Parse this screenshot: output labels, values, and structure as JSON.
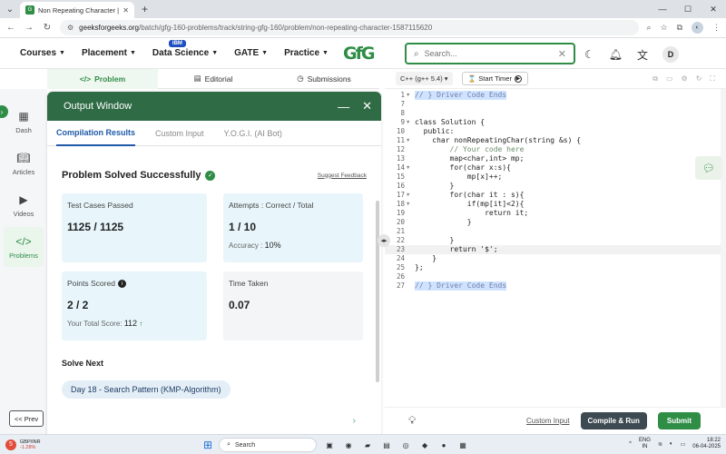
{
  "browser": {
    "tab_title": "Non Repeating Character | Pra",
    "url_host": "geeksforgeeks.org",
    "url_path": "/batch/gfg-160-problems/track/string-gfg-160/problem/non-repeating-character-1587115620"
  },
  "header": {
    "logo": "GfG",
    "nav": [
      {
        "label": "Courses"
      },
      {
        "label": "Placement"
      },
      {
        "label": "Data Science",
        "badge": "IBM"
      },
      {
        "label": "GATE"
      },
      {
        "label": "Practice"
      }
    ],
    "search_placeholder": "Search...",
    "avatar_initial": "D"
  },
  "problem_tabs": [
    "Problem",
    "Editorial",
    "Submissions"
  ],
  "sidebar": {
    "items": [
      {
        "label": "Dash",
        "icon": "dashboard-icon"
      },
      {
        "label": "Articles",
        "icon": "book-icon"
      },
      {
        "label": "Videos",
        "icon": "video-icon"
      },
      {
        "label": "Problems",
        "icon": "code-icon",
        "active": true
      }
    ],
    "prev_label": "<< Prev"
  },
  "output_window": {
    "title": "Output Window",
    "tabs": [
      "Compilation Results",
      "Custom Input",
      "Y.O.G.I. (AI Bot)"
    ],
    "result_title": "Problem Solved Successfully",
    "feedback_link": "Suggest Feedback",
    "cards": {
      "test_cases_label": "Test Cases Passed",
      "test_cases_value": "1125 / 1125",
      "attempts_label": "Attempts : Correct / Total",
      "attempts_value": "1 / 10",
      "accuracy_label": "Accuracy :",
      "accuracy_value": "10%",
      "points_label": "Points Scored",
      "points_value": "2 / 2",
      "total_score_label": "Your Total Score:",
      "total_score_value": "112",
      "time_label": "Time Taken",
      "time_value": "0.07"
    },
    "solve_next_label": "Solve Next",
    "next_problem": "Day 18 - Search Pattern (KMP-Algorithm)"
  },
  "editor": {
    "language": "C++ (g++ 5.4)",
    "timer_label": "Start Timer",
    "lines": [
      {
        "n": "1",
        "text": "// } Driver Code Ends",
        "fold": true,
        "hl": true
      },
      {
        "n": "7",
        "text": ""
      },
      {
        "n": "8",
        "text": ""
      },
      {
        "n": "9",
        "text": "class Solution {",
        "fold": true
      },
      {
        "n": "10",
        "text": "  public:"
      },
      {
        "n": "11",
        "text": "    char nonRepeatingChar(string &s) {",
        "fold": true
      },
      {
        "n": "12",
        "text": "        // Your code here"
      },
      {
        "n": "13",
        "text": "        map<char,int> mp;"
      },
      {
        "n": "14",
        "text": "        for(char x:s){",
        "fold": true
      },
      {
        "n": "15",
        "text": "            mp[x]++;"
      },
      {
        "n": "16",
        "text": "        }"
      },
      {
        "n": "17",
        "text": "        for(char it : s){",
        "fold": true
      },
      {
        "n": "18",
        "text": "            if(mp[it]<2){",
        "fold": true
      },
      {
        "n": "19",
        "text": "                return it;"
      },
      {
        "n": "20",
        "text": "            }"
      },
      {
        "n": "21",
        "text": ""
      },
      {
        "n": "22",
        "text": "        }"
      },
      {
        "n": "23",
        "text": "        return '$';",
        "current": true
      },
      {
        "n": "24",
        "text": "    }"
      },
      {
        "n": "25",
        "text": "};"
      },
      {
        "n": "26",
        "text": ""
      },
      {
        "n": "27",
        "text": "// } Driver Code Ends",
        "hl": true
      }
    ],
    "custom_input": "Custom Input",
    "compile_label": "Compile & Run",
    "submit_label": "Submit"
  },
  "taskbar": {
    "ticker_name": "GBP/INR",
    "ticker_change": "-1.28%",
    "search_label": "Search",
    "lang_top": "ENG",
    "lang_bottom": "IN",
    "time": "18:22",
    "date": "06-04-2025"
  }
}
